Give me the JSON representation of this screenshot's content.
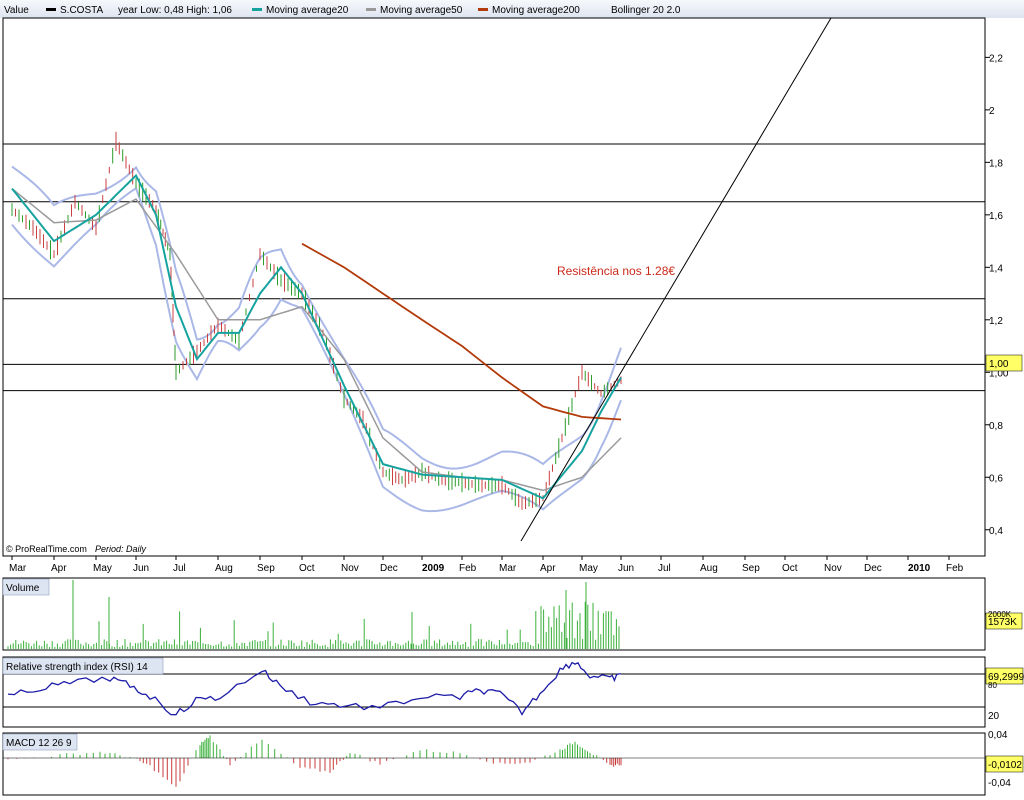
{
  "legend": {
    "value_label": "Value",
    "symbol": "S.COSTA",
    "year_range": "year Low: 0,48 High: 1,06",
    "ma20_label": "Moving average20",
    "ma50_label": "Moving average50",
    "ma200_label": "Moving average200",
    "bollinger_label": "Bollinger 20 2.0"
  },
  "colors": {
    "price_up": "#2a9d2a",
    "price_down": "#c84040",
    "ma20": "#16a3a0",
    "ma50": "#9a9a9a",
    "ma200": "#b33a0a",
    "bollinger": "#aab8e8",
    "rsi": "#1c1ca8",
    "macd_up": "#3ab03a",
    "macd_down": "#c83a3a",
    "volume": "#3ab03a"
  },
  "watermark": "© ProRealTime.com",
  "period_label": "Period: Daily",
  "annotation": "Resistência nos 1.28€",
  "chart_data": [
    {
      "type": "line",
      "name": "price",
      "ylim": [
        0.3,
        2.35
      ],
      "yticks": [
        "0,4",
        "0,6",
        "0,8",
        "1,00",
        "1,2",
        "1,4",
        "1,6",
        "1,8",
        "2",
        "2,2"
      ],
      "ytick_values": [
        0.4,
        0.6,
        0.8,
        1.0,
        1.2,
        1.4,
        1.6,
        1.8,
        2.0,
        2.2
      ],
      "current_value": "1,00",
      "xticks": [
        "Mar",
        "Apr",
        "May",
        "Jun",
        "Jul",
        "Aug",
        "Sep",
        "Oct",
        "Nov",
        "Dec",
        "2009",
        "Feb",
        "Mar",
        "Apr",
        "May",
        "Jun",
        "Jul",
        "Aug",
        "Sep",
        "Oct",
        "Nov",
        "Dec",
        "2010",
        "Feb"
      ],
      "horizontal_lines": [
        1.87,
        1.65,
        1.28,
        1.03,
        0.93
      ],
      "trendline": {
        "from": [
          "2009-03-28",
          0.3
        ],
        "to": [
          "2009-12-01",
          2.33
        ]
      },
      "series": [
        {
          "name": "S.COSTA",
          "kind": "price",
          "points": [
            [
              "Mar",
              1.62
            ],
            [
              "Mar-mid",
              1.55
            ],
            [
              "Apr",
              1.45
            ],
            [
              "Apr-mid",
              1.65
            ],
            [
              "May",
              1.55
            ],
            [
              "May-mid",
              1.88
            ],
            [
              "Jun",
              1.72
            ],
            [
              "Jun-mid",
              1.62
            ],
            [
              "Jul-early",
              1.45
            ],
            [
              "Jul",
              1.0
            ],
            [
              "Jul-mid",
              1.08
            ],
            [
              "Aug",
              1.18
            ],
            [
              "Aug-mid",
              1.12
            ],
            [
              "Sep",
              1.45
            ],
            [
              "Sep-mid",
              1.35
            ],
            [
              "Oct",
              1.3
            ],
            [
              "Oct-mid",
              1.15
            ],
            [
              "Nov",
              0.9
            ],
            [
              "Nov-mid",
              0.82
            ],
            [
              "Dec",
              0.62
            ],
            [
              "Dec-mid",
              0.59
            ],
            [
              "2009",
              0.62
            ],
            [
              "Jan-mid",
              0.59
            ],
            [
              "Feb",
              0.58
            ],
            [
              "Feb-mid",
              0.57
            ],
            [
              "Mar",
              0.57
            ],
            [
              "Mar-mid",
              0.5
            ],
            [
              "Apr",
              0.52
            ],
            [
              "Apr-mid",
              0.75
            ],
            [
              "May",
              1.0
            ],
            [
              "May-mid",
              0.92
            ],
            [
              "Jun",
              0.97
            ]
          ]
        },
        {
          "name": "Moving average20",
          "kind": "ma20",
          "points": [
            [
              "Mar",
              1.7
            ],
            [
              "Apr",
              1.5
            ],
            [
              "May",
              1.6
            ],
            [
              "Jun",
              1.75
            ],
            [
              "Jun-mid",
              1.6
            ],
            [
              "Jul",
              1.25
            ],
            [
              "Jul-mid",
              1.05
            ],
            [
              "Aug",
              1.15
            ],
            [
              "Aug-mid",
              1.15
            ],
            [
              "Sep",
              1.3
            ],
            [
              "Sep-mid",
              1.4
            ],
            [
              "Oct",
              1.3
            ],
            [
              "Nov",
              0.95
            ],
            [
              "Dec",
              0.65
            ],
            [
              "2009",
              0.61
            ],
            [
              "Feb",
              0.6
            ],
            [
              "Mar",
              0.59
            ],
            [
              "Apr",
              0.52
            ],
            [
              "May",
              0.7
            ],
            [
              "May-mid",
              0.85
            ],
            [
              "Jun",
              0.98
            ]
          ]
        },
        {
          "name": "Moving average50",
          "kind": "ma50",
          "points": [
            [
              "Mar",
              1.7
            ],
            [
              "Apr",
              1.57
            ],
            [
              "May",
              1.58
            ],
            [
              "Jun",
              1.66
            ],
            [
              "Jul",
              1.45
            ],
            [
              "Aug",
              1.2
            ],
            [
              "Sep",
              1.2
            ],
            [
              "Oct",
              1.25
            ],
            [
              "Nov",
              1.05
            ],
            [
              "Dec",
              0.75
            ],
            [
              "2009",
              0.62
            ],
            [
              "Feb",
              0.6
            ],
            [
              "Mar",
              0.59
            ],
            [
              "Apr",
              0.55
            ],
            [
              "May",
              0.6
            ],
            [
              "Jun",
              0.75
            ]
          ]
        },
        {
          "name": "Moving average200",
          "kind": "ma200",
          "points": [
            [
              "Oct",
              1.49
            ],
            [
              "Nov",
              1.4
            ],
            [
              "Dec",
              1.3
            ],
            [
              "2009",
              1.2
            ],
            [
              "Feb",
              1.1
            ],
            [
              "Mar",
              0.98
            ],
            [
              "Apr",
              0.87
            ],
            [
              "May",
              0.83
            ],
            [
              "Jun",
              0.82
            ]
          ]
        }
      ]
    },
    {
      "type": "bar",
      "name": "Volume",
      "title": "Volume",
      "current_value": "1573K",
      "ylim": [
        0,
        5000
      ],
      "axis_label": "2000K"
    },
    {
      "type": "line",
      "name": "RSI",
      "title": "Relative strength index (RSI) 14",
      "current_value": "69,2999",
      "ylim": [
        0,
        100
      ],
      "yticks": [
        "20",
        "80"
      ],
      "levels": [
        70,
        30
      ]
    },
    {
      "type": "bar",
      "name": "MACD",
      "title": "MACD 12 26 9",
      "current_value": "-0,0102",
      "ylim": [
        -0.05,
        0.05
      ],
      "yticks": [
        "0,04",
        "-0,04"
      ]
    }
  ]
}
